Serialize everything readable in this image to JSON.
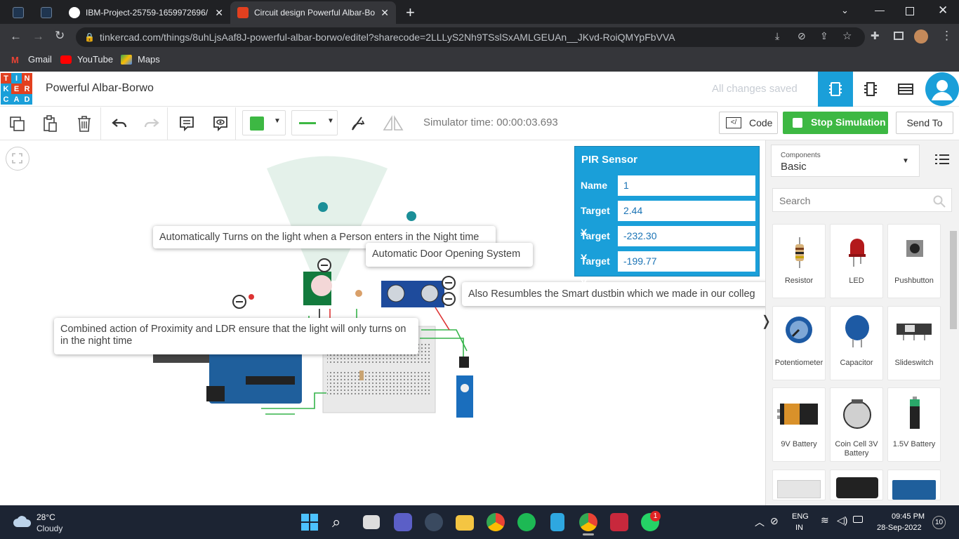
{
  "tabs": [
    {
      "title": ""
    },
    {
      "title": ""
    },
    {
      "title": "IBM-Project-25759-1659972696/"
    },
    {
      "title": "Circuit design Powerful Albar-Bor"
    }
  ],
  "address": {
    "url": "tinkercad.com/things/8uhLjsAaf8J-powerful-albar-borwo/editel?sharecode=2LLLyS2Nh9TSslSxAMLGEUAn__JKvd-RoiQMYpFbVVA"
  },
  "bookmarks": [
    "Gmail",
    "YouTube",
    "Maps"
  ],
  "header": {
    "logo_letters": [
      "T",
      "I",
      "N",
      "K",
      "E",
      "R",
      "C",
      "A",
      "D"
    ],
    "logo_colors": [
      "#e2401f",
      "#1a9fd9",
      "#e2401f",
      "#1a9fd9",
      "#e2401f",
      "#e2401f",
      "#1a9fd9",
      "#1a9fd9",
      "#1a9fd9"
    ],
    "project_title": "Powerful Albar-Borwo",
    "save_status": "All changes saved"
  },
  "toolbar": {
    "sim_time": "Simulator time: 00:00:03.693",
    "code_label": "Code",
    "stop_label": "Stop Simulation",
    "send_label": "Send To",
    "fill_color": "#3db843",
    "accent": "#1a9fd9"
  },
  "canvas": {
    "notes": [
      "Automatically Turns on the light when a Person enters in the Night time",
      "Automatic Door Opening System",
      "Also Resumbles the Smart dustbin which we made in our colleg",
      "Combined action of Proximity and LDR ensure that the light will only turns on in the night time"
    ]
  },
  "inspector": {
    "title": "PIR Sensor",
    "rows": [
      {
        "label": "Name",
        "value": "1"
      },
      {
        "label": "Target X",
        "value": "2.44"
      },
      {
        "label": "Target Y",
        "value": "-232.30"
      },
      {
        "label": "Target Y",
        "value": "-199.77"
      }
    ]
  },
  "panel": {
    "components_label": "Components",
    "components_value": "Basic",
    "search_placeholder": "Search",
    "items": [
      {
        "name": "Resistor"
      },
      {
        "name": "LED"
      },
      {
        "name": "Pushbutton"
      },
      {
        "name": "Potentiometer"
      },
      {
        "name": "Capacitor"
      },
      {
        "name": "Slideswitch"
      },
      {
        "name": "9V Battery"
      },
      {
        "name": "Coin Cell 3V Battery"
      },
      {
        "name": "1.5V Battery"
      }
    ]
  },
  "taskbar": {
    "weather_temp": "28°C",
    "weather_desc": "Cloudy",
    "lang": "ENG",
    "region": "IN",
    "time": "09:45 PM",
    "date": "28-Sep-2022",
    "notif_count": "10",
    "whatsapp_badge": "1"
  }
}
